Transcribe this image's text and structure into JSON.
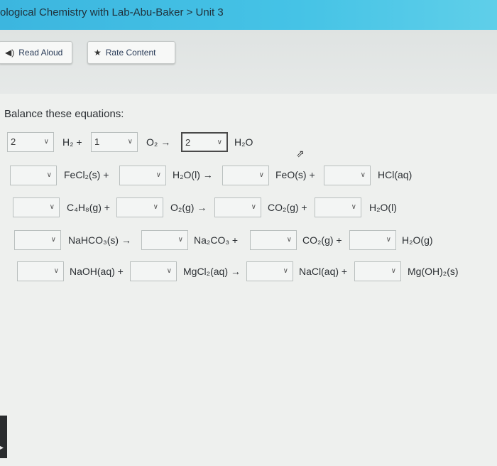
{
  "breadcrumb": "ological Chemistry with Lab-Abu-Baker > Unit 3",
  "toolbar": {
    "read_aloud": "Read Aloud",
    "rate_content": "Rate Content"
  },
  "prompt": "Balance these equations:",
  "equations": [
    {
      "coefficients": [
        "2",
        "1",
        "2"
      ],
      "species": [
        "H₂ +",
        "O₂ →",
        "H₂O"
      ]
    },
    {
      "coefficients": [
        "",
        "",
        "",
        ""
      ],
      "species": [
        "FeCl₂(s) +",
        "H₂O(l) →",
        "FeO(s) +",
        "HCl(aq)"
      ]
    },
    {
      "coefficients": [
        "",
        "",
        "",
        ""
      ],
      "species": [
        "C₄H₈(g) +",
        "O₂(g) →",
        "CO₂(g) +",
        "H₂O(l)"
      ]
    },
    {
      "coefficients": [
        "",
        "",
        "",
        ""
      ],
      "species": [
        "NaHCO₃(s) →",
        "Na₂CO₃ +",
        "CO₂(g) +",
        "H₂O(g)"
      ]
    },
    {
      "coefficients": [
        "",
        "",
        "",
        ""
      ],
      "species": [
        "NaOH(aq) +",
        "MgCl₂(aq) →",
        "NaCl(aq) +",
        "Mg(OH)₂(s)"
      ]
    }
  ],
  "icons": {
    "read_aloud": "speaker-icon",
    "rate_content": "star-icon",
    "dropdown": "chevron-down-icon",
    "cursor": "mouse-pointer-icon"
  },
  "colors": {
    "topbar": "#45c3e6",
    "background": "#eef0ee"
  }
}
